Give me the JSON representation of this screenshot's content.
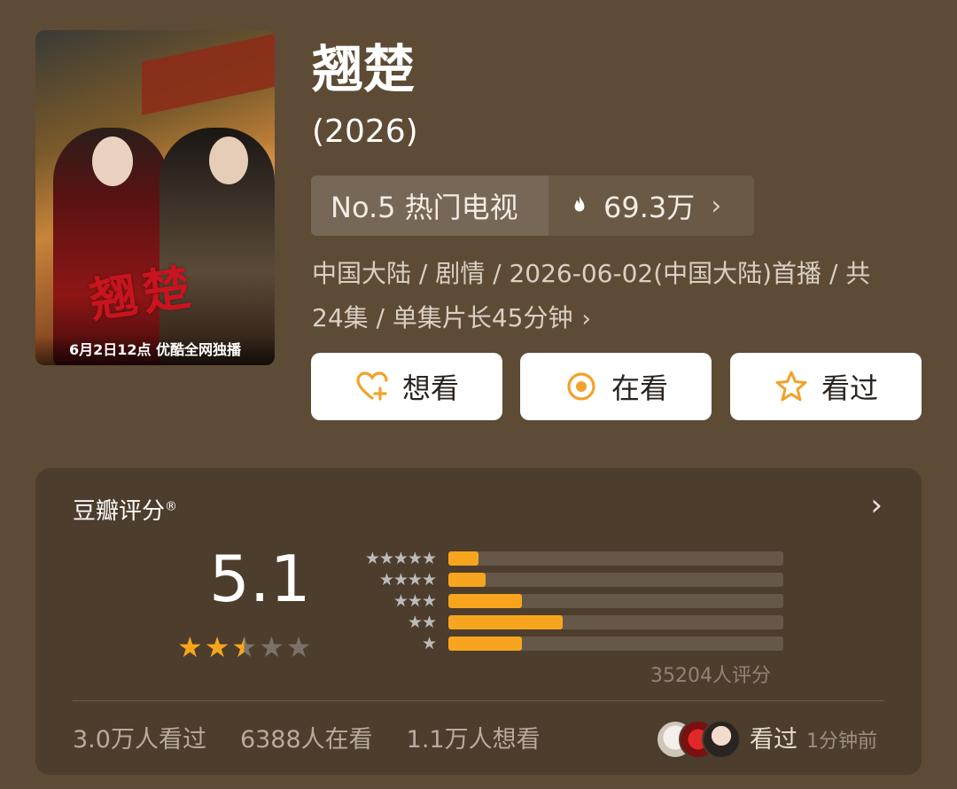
{
  "poster": {
    "calligraphy": "翘楚",
    "caption": "6月2日12点 优酷全网独播"
  },
  "title": "翘楚",
  "year": "(2026)",
  "rank": {
    "label": "No.5 热门电视",
    "heat": "69.3万"
  },
  "meta": {
    "line1": "中国大陆 / 剧情 / 2026-06-02(中国大陆)首播 / 共",
    "line2": "24集 / 单集片长45分钟"
  },
  "buttons": {
    "want": "想看",
    "watching": "在看",
    "watched": "看过"
  },
  "rating": {
    "label": "豆瓣评分",
    "reg": "®",
    "score": "5.1",
    "star_value": 2.5,
    "distribution": [
      {
        "stars": "★★★★★",
        "percent": 9
      },
      {
        "stars": "★★★★",
        "percent": 11
      },
      {
        "stars": "★★★",
        "percent": 22
      },
      {
        "stars": "★★",
        "percent": 34
      },
      {
        "stars": "★",
        "percent": 22
      }
    ],
    "votes": "35204人评分"
  },
  "stats": {
    "watched": "3.0万人看过",
    "watching": "6388人在看",
    "want": "1.1万人想看"
  },
  "recent": {
    "label": "看过",
    "time": "1分钟前"
  },
  "colors": {
    "background": "#5e4b36",
    "accent": "#f7a51e",
    "button_icon": "#f2a22a"
  }
}
